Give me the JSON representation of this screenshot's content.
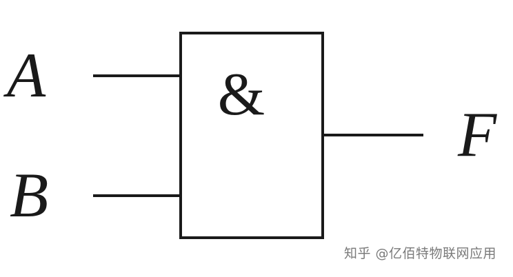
{
  "gate": {
    "symbol": "&",
    "inputs": [
      {
        "label": "A"
      },
      {
        "label": "B"
      }
    ],
    "output": {
      "label": "F"
    }
  },
  "watermark": {
    "text": "知乎 @亿佰特物联网应用"
  },
  "colors": {
    "line": "#1a1a1a",
    "background": "#ffffff",
    "watermark": "#7a7a7a"
  }
}
